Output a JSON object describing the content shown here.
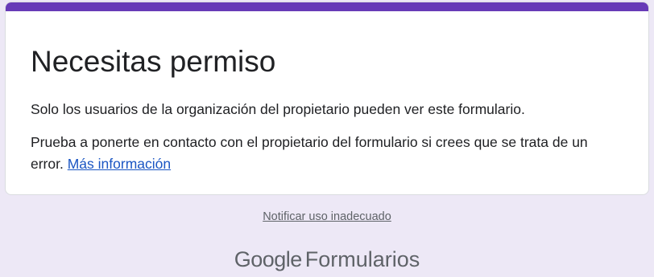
{
  "card": {
    "title": "Necesitas permiso",
    "paragraph_1": "Solo los usuarios de la organización del propietario pueden ver este formulario.",
    "paragraph_2": "Prueba a ponerte en contacto con el propietario del formulario si crees que se trata de un error.",
    "learn_more_link": "Más información"
  },
  "report_link": "Notificar uso inadecuado",
  "footer": {
    "brand": "Google",
    "product": "Formularios"
  },
  "colors": {
    "accent": "#673ab7",
    "background": "#ede8f6",
    "link": "#1a55c3"
  }
}
